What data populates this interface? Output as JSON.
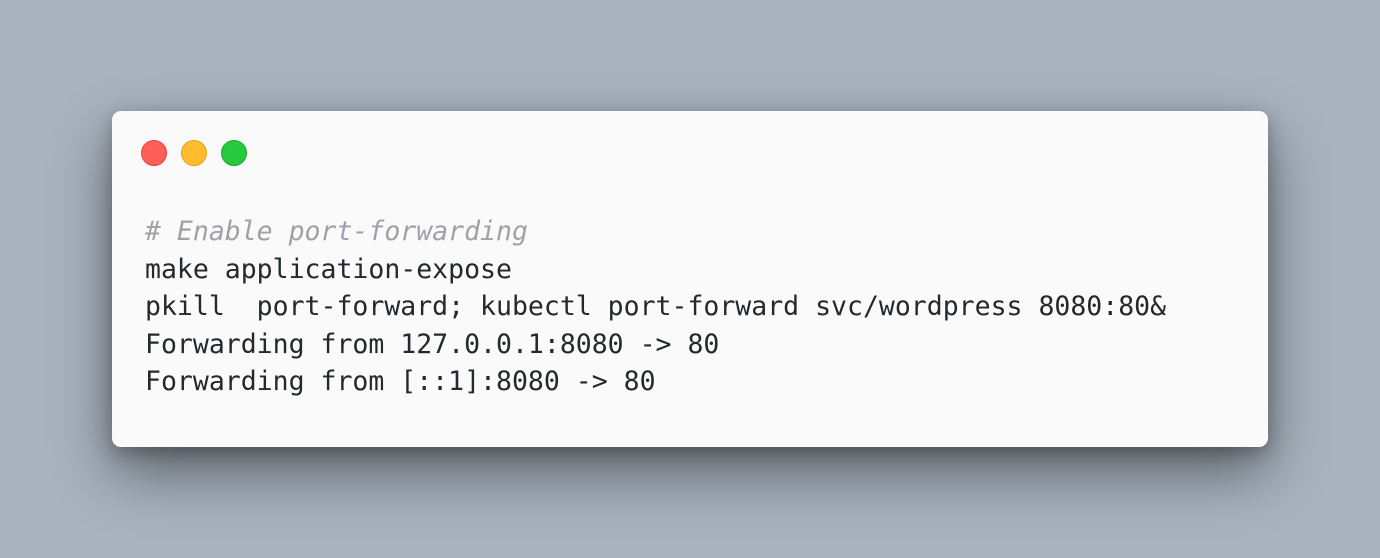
{
  "window": {
    "controls": [
      {
        "name": "close",
        "color": "#ff5f56",
        "border": "#e0443e"
      },
      {
        "name": "minimize",
        "color": "#ffbd2e",
        "border": "#dea123"
      },
      {
        "name": "maximize",
        "color": "#27c93f",
        "border": "#1aab29"
      }
    ]
  },
  "colors": {
    "background": "#a8b3bf",
    "window_bg": "#fafafa",
    "text": "#24292e",
    "comment": "#a0a1a7"
  },
  "code": {
    "lines": [
      {
        "text": "# Enable port-forwarding",
        "type": "comment"
      },
      {
        "text": "make application-expose",
        "type": "command"
      },
      {
        "text": "pkill  port-forward; kubectl port-forward svc/wordpress 8080:80&",
        "type": "command"
      },
      {
        "text": "Forwarding from 127.0.0.1:8080 -> 80",
        "type": "output"
      },
      {
        "text": "Forwarding from [::1]:8080 -> 80",
        "type": "output"
      }
    ]
  }
}
